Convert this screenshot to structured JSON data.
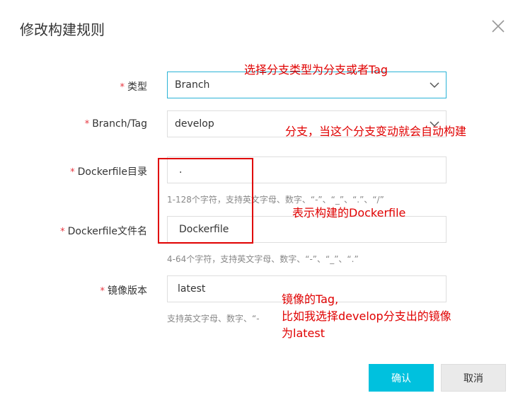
{
  "dialog": {
    "title": "修改构建规则",
    "close_icon": "close-icon"
  },
  "form": {
    "type": {
      "required": "*",
      "label": "类型",
      "value": "Branch"
    },
    "branch": {
      "required": "*",
      "label": "Branch/Tag",
      "value": "develop"
    },
    "dockerfile_dir": {
      "required": "*",
      "label": "Dockerfile目录",
      "value": ".",
      "hint": "1-128个字符，支持英文字母、数字、“-”、“_”、“.”、“/”"
    },
    "dockerfile_name": {
      "required": "*",
      "label": "Dockerfile文件名",
      "value": "Dockerfile",
      "hint": "4-64个字符，支持英文字母、数字、“-”、“_”、“.”"
    },
    "image_version": {
      "required": "*",
      "label": "镜像版本",
      "value": "latest",
      "hint": "支持英文字母、数字、“-"
    }
  },
  "annotations": {
    "type": "选择分支类型为分支或者Tag",
    "branch": "分支，当这个分支变动就会自动构建",
    "dockerfile": "表示构建的Dockerfile",
    "image_line1": "镜像的Tag,",
    "image_line2": "比如我选择develop分支出的镜像",
    "image_line3": "为latest",
    "color": "#e00000"
  },
  "buttons": {
    "confirm": "确认",
    "cancel": "取消"
  },
  "colors": {
    "accent": "#00c1de",
    "focus_border": "#2ab3d6",
    "required": "#e7353f"
  }
}
